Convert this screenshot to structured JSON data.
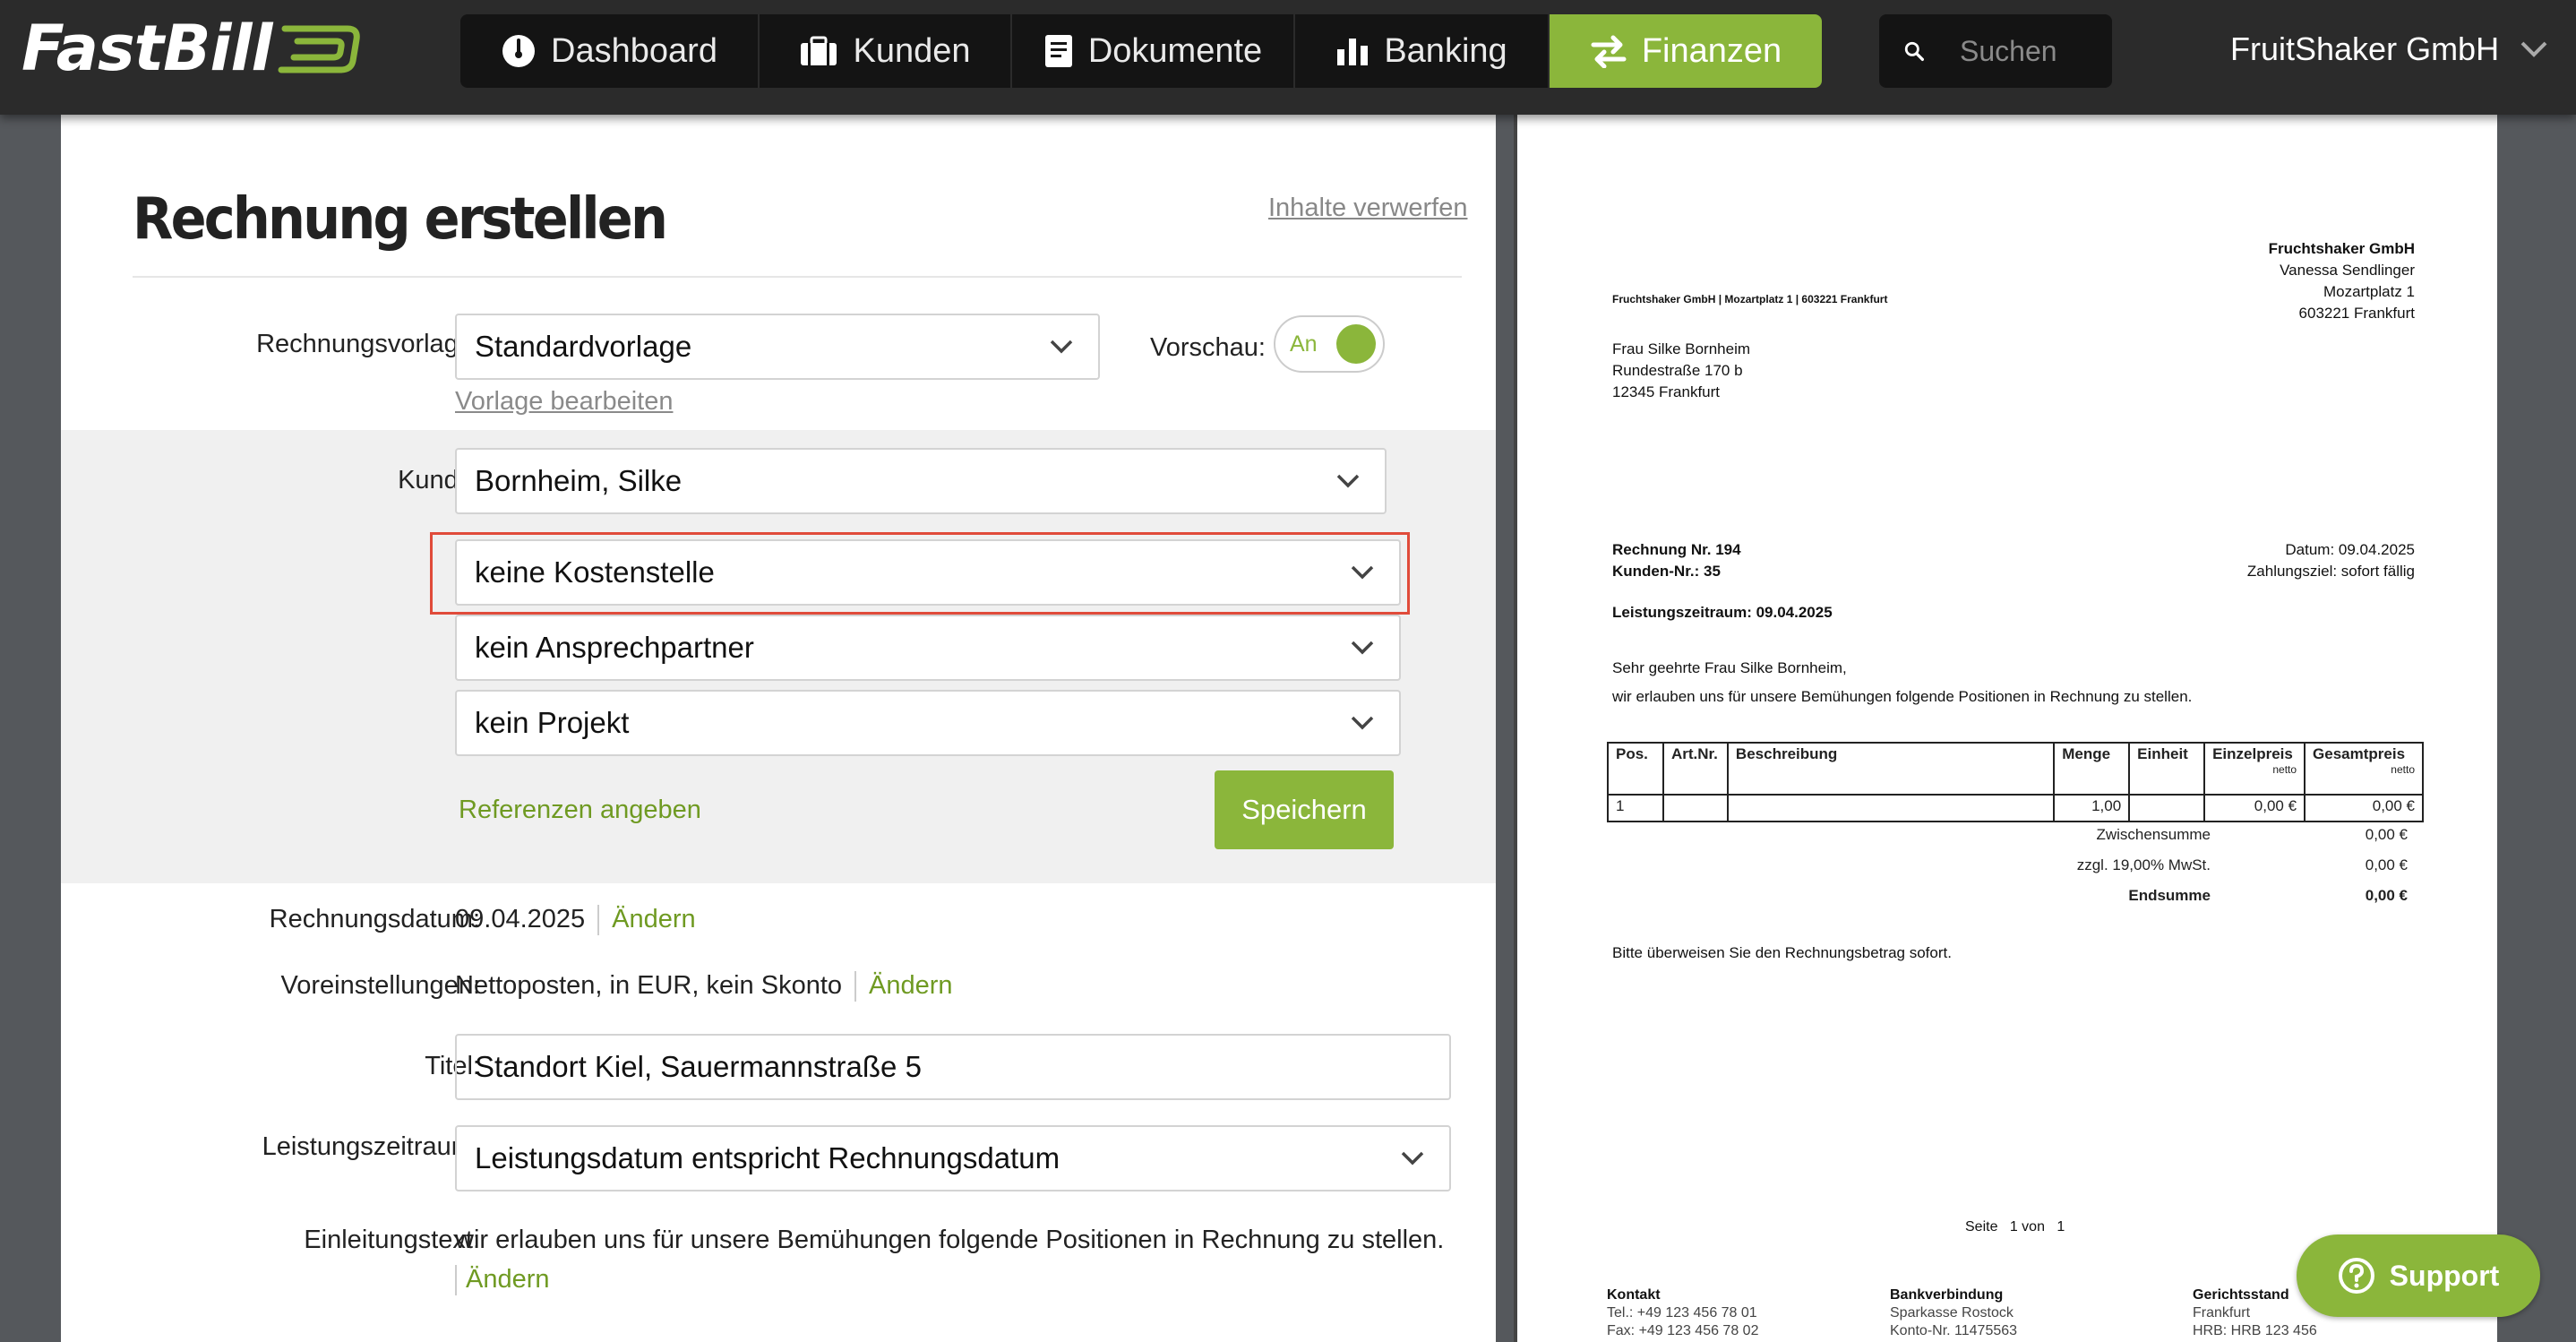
{
  "app": {
    "logo": "FastBill",
    "company": "FruitShaker GmbH"
  },
  "nav": [
    {
      "label": "Dashboard",
      "icon": "gauge-icon"
    },
    {
      "label": "Kunden",
      "icon": "briefcase-icon"
    },
    {
      "label": "Dokumente",
      "icon": "document-icon"
    },
    {
      "label": "Banking",
      "icon": "bar-chart-icon"
    },
    {
      "label": "Finanzen",
      "icon": "transfer-arrows-icon",
      "active": true
    }
  ],
  "search": {
    "placeholder": "Suchen"
  },
  "form": {
    "title": "Rechnung erstellen",
    "discard_link": "Inhalte verwerfen",
    "template_label": "Rechnungsvorlage:",
    "template_value": "Standardvorlage",
    "edit_template_link": "Vorlage bearbeiten",
    "preview_label": "Vorschau:",
    "preview_toggle": "An",
    "customer_label": "Kunde:",
    "customer_value": "Bornheim, Silke",
    "cost_center_value": "keine Kostenstelle",
    "contact_value": "kein Ansprechpartner",
    "project_value": "kein Projekt",
    "references_link": "Referenzen angeben",
    "save_button": "Speichern",
    "date_label": "Rechnungsdatum:",
    "date_value": "09.04.2025",
    "change_link": "Ändern",
    "presets_label": "Voreinstellungen:",
    "presets_value": "Nettoposten, in EUR, kein Skonto",
    "title_label": "Titel:",
    "title_value": "Standort Kiel, Sauermannstraße 5",
    "period_label": "Leistungszeitraum:",
    "period_value": "Leistungsdatum entspricht Rechnungsdatum",
    "intro_label": "Einleitungstext:",
    "intro_value": "wir erlauben uns für unsere Bemühungen folgende Positionen in Rechnung zu stellen."
  },
  "preview": {
    "sender_line": "Fruchtshaker GmbH | Mozartplatz 1 | 603221 Frankfurt",
    "sender_name": "Fruchtshaker GmbH",
    "sender_person": "Vanessa Sendlinger",
    "sender_street": "Mozartplatz 1",
    "sender_city": "603221 Frankfurt",
    "recipient_name": "Frau Silke Bornheim",
    "recipient_street": "Rundestraße 170 b",
    "recipient_city": "12345 Frankfurt",
    "invoice_no": "Rechnung Nr. 194",
    "customer_no": "Kunden-Nr.: 35",
    "date": "Datum: 09.04.2025",
    "due": "Zahlungsziel: sofort fällig",
    "period": "Leistungszeitraum: 09.04.2025",
    "salutation": "Sehr geehrte Frau Silke Bornheim,",
    "intro": "wir erlauben uns für unsere Bemühungen folgende Positionen in Rechnung zu stellen.",
    "table": {
      "headers": [
        "Pos.",
        "Art.Nr.",
        "Beschreibung",
        "Menge",
        "Einheit",
        "Einzelpreis",
        "Gesamtpreis"
      ],
      "netto": "netto",
      "row": [
        "1",
        "",
        "",
        "1,00",
        "",
        "0,00 €",
        "0,00 €"
      ]
    },
    "subtotal_label": "Zwischensumme",
    "subtotal_value": "0,00 €",
    "vat_label": "zzgl. 19,00% MwSt.",
    "vat_value": "0,00 €",
    "total_label": "Endsumme",
    "total_value": "0,00 €",
    "payment_note": "Bitte überweisen Sie den Rechnungsbetrag sofort.",
    "page_label": "Seite",
    "page_current": "1",
    "page_of": "von",
    "page_total": "1",
    "footer": {
      "contact_title": "Kontakt",
      "contact_tel": "Tel.: +49 123 456 78 01",
      "contact_fax": "Fax: +49 123 456 78 02",
      "bank_title": "Bankverbindung",
      "bank_name": "Sparkasse Rostock",
      "bank_account": "Konto-Nr. 11475563",
      "court_title": "Gerichtsstand",
      "court_city": "Frankfurt",
      "court_hrb": "HRB: HRB 123 456"
    }
  },
  "support": {
    "label": "Support"
  }
}
